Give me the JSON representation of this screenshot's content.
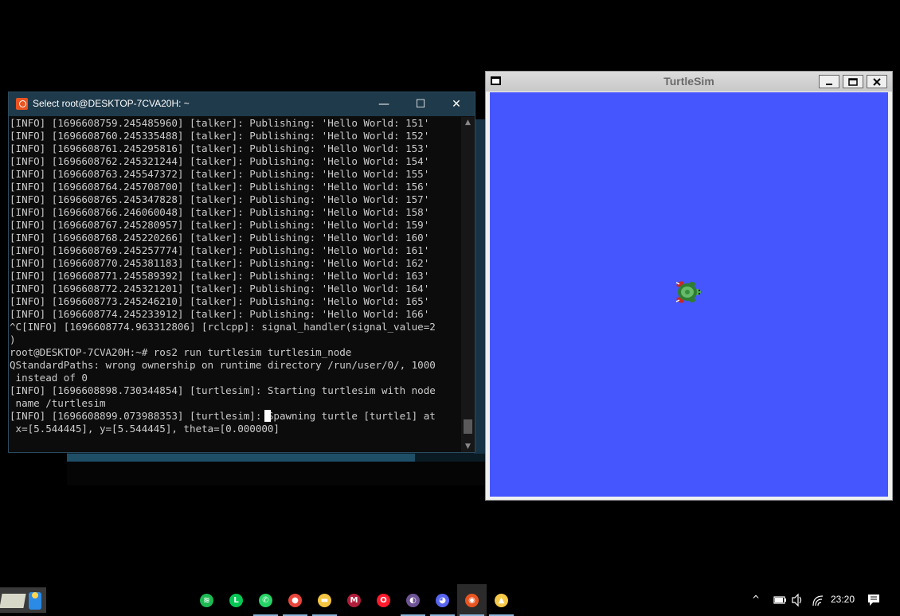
{
  "terminal": {
    "title": "Select root@DESKTOP-7CVA20H: ~",
    "lines": [
      "[INFO] [1696608759.245485960] [talker]: Publishing: 'Hello World: 151'",
      "[INFO] [1696608760.245335488] [talker]: Publishing: 'Hello World: 152'",
      "[INFO] [1696608761.245295816] [talker]: Publishing: 'Hello World: 153'",
      "[INFO] [1696608762.245321244] [talker]: Publishing: 'Hello World: 154'",
      "[INFO] [1696608763.245547372] [talker]: Publishing: 'Hello World: 155'",
      "[INFO] [1696608764.245708700] [talker]: Publishing: 'Hello World: 156'",
      "[INFO] [1696608765.245347828] [talker]: Publishing: 'Hello World: 157'",
      "[INFO] [1696608766.246060048] [talker]: Publishing: 'Hello World: 158'",
      "[INFO] [1696608767.245280957] [talker]: Publishing: 'Hello World: 159'",
      "[INFO] [1696608768.245220266] [talker]: Publishing: 'Hello World: 160'",
      "[INFO] [1696608769.245257774] [talker]: Publishing: 'Hello World: 161'",
      "[INFO] [1696608770.245381183] [talker]: Publishing: 'Hello World: 162'",
      "[INFO] [1696608771.245589392] [talker]: Publishing: 'Hello World: 163'",
      "[INFO] [1696608772.245321201] [talker]: Publishing: 'Hello World: 164'",
      "[INFO] [1696608773.245246210] [talker]: Publishing: 'Hello World: 165'",
      "[INFO] [1696608774.245233912] [talker]: Publishing: 'Hello World: 166'",
      "^C[INFO] [1696608774.963312806] [rclcpp]: signal_handler(signal_value=2",
      ")",
      "root@DESKTOP-7CVA20H:~# ros2 run turtlesim turtlesim_node",
      "QStandardPaths: wrong ownership on runtime directory /run/user/0/, 1000",
      " instead of 0",
      "[INFO] [1696608898.730344854] [turtlesim]: Starting turtlesim with node",
      " name /turtlesim",
      "[INFO] [1696608899.073988353] [turtlesim]: Spawning turtle [turtle1] at",
      " x=[5.544445], y=[5.544445], theta=[0.000000]"
    ]
  },
  "turtlesim": {
    "title": "TurtleSim",
    "background_color": "#4556ff"
  },
  "window_controls": {
    "minimize": "—",
    "maximize": "☐",
    "close": "✕"
  },
  "taskbar": {
    "apps": [
      {
        "name": "spotify-icon",
        "color": "#1db954",
        "glyph": "≋"
      },
      {
        "name": "line-icon",
        "color": "#06c755",
        "glyph": "L"
      },
      {
        "name": "whatsapp-icon",
        "color": "#25d366",
        "glyph": "✆"
      },
      {
        "name": "chrome-icon",
        "color": "#e8453c",
        "glyph": "●"
      },
      {
        "name": "file-explorer-icon",
        "color": "#f4c542",
        "glyph": "▬"
      },
      {
        "name": "mendeley-icon",
        "color": "#b01e3b",
        "glyph": "M"
      },
      {
        "name": "opera-icon",
        "color": "#ff1b2d",
        "glyph": "O"
      },
      {
        "name": "github-icon",
        "color": "#6e5494",
        "glyph": "◐"
      },
      {
        "name": "discord-icon",
        "color": "#5865f2",
        "glyph": "◕"
      },
      {
        "name": "ubuntu-terminal-icon",
        "color": "#e95420",
        "glyph": "◉"
      },
      {
        "name": "linux-tux-icon",
        "color": "#f7c948",
        "glyph": "▲"
      }
    ],
    "clock": "23:20"
  }
}
